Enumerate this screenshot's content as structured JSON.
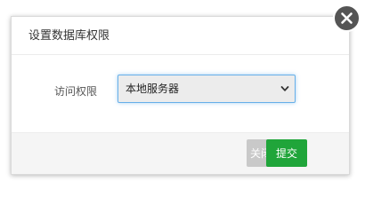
{
  "dialog": {
    "title": "设置数据库权限",
    "access_label": "访问权限",
    "access_select": {
      "selected": "本地服务器"
    },
    "buttons": {
      "close": "关闭",
      "submit": "提交"
    }
  },
  "icons": {
    "close": "close-x-icon",
    "select_caret": "chevron-down-icon"
  },
  "colors": {
    "submit": "#20a53a",
    "close_button": "#c9c9c9",
    "select_focus_border": "#66afe9",
    "close_circle": "#555555"
  }
}
